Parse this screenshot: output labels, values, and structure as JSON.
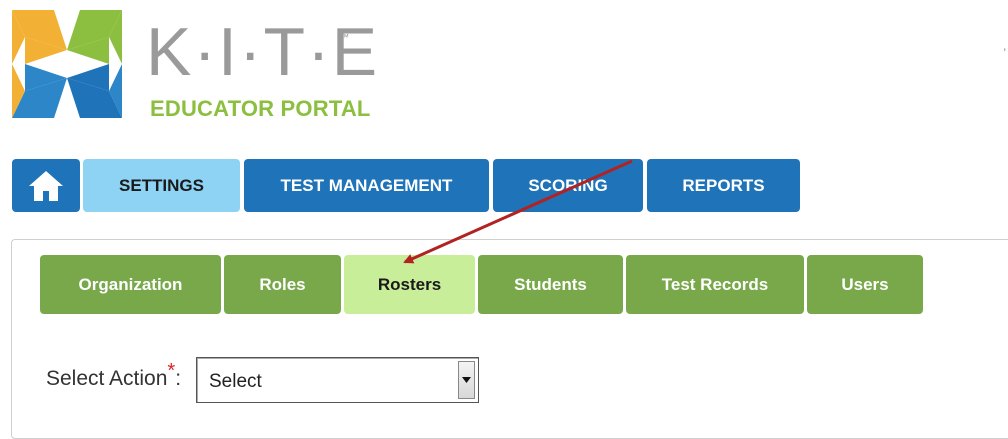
{
  "brand": {
    "wordmark": "K·I·T·E",
    "trademark": "™",
    "subtitle": "EDUCATOR PORTAL",
    "logo_icon": "kite-logo-icon"
  },
  "top_nav": {
    "home_icon": "home-icon",
    "tabs": [
      {
        "label": "SETTINGS",
        "active": true
      },
      {
        "label": "TEST MANAGEMENT",
        "active": false
      },
      {
        "label": "SCORING",
        "active": false
      },
      {
        "label": "REPORTS",
        "active": false
      }
    ]
  },
  "sub_nav": {
    "tabs": [
      {
        "label": "Organization",
        "active": false
      },
      {
        "label": "Roles",
        "active": false
      },
      {
        "label": "Rosters",
        "active": true
      },
      {
        "label": "Students",
        "active": false
      },
      {
        "label": "Test Records",
        "active": false
      },
      {
        "label": "Users",
        "active": false
      }
    ]
  },
  "action": {
    "label": "Select Action",
    "required_mark": "*",
    "colon": ":",
    "selected": "Select"
  },
  "colors": {
    "top_nav": "#1f73b8",
    "top_nav_active": "#8fd3f4",
    "sub_nav": "#79a84b",
    "sub_nav_active": "#c8ee9a",
    "brand_green": "#8cbf3f",
    "annotation_arrow": "#b22222"
  },
  "annotation": {
    "type": "arrow",
    "from": "scoring-tab",
    "to": "subnav-tab-rosters"
  }
}
